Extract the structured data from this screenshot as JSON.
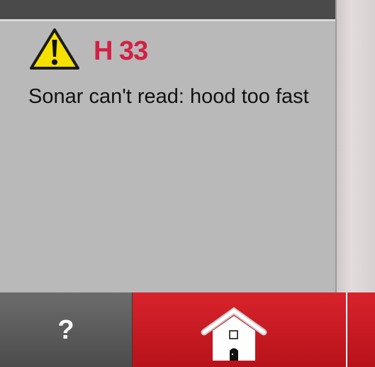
{
  "alert": {
    "icon": "warning-triangle-icon",
    "code": "H 33",
    "message": "Sonar can't read: hood too fast"
  },
  "colors": {
    "code_red": "#d31f45",
    "panel_gray": "#b9b9b9",
    "button_red": "#c8181f",
    "help_gray": "#5c5c5c",
    "warning_yellow": "#f5e000"
  },
  "toolbar": {
    "help_label": "?",
    "help_icon": "question-mark-icon",
    "home_icon": "home-icon"
  }
}
